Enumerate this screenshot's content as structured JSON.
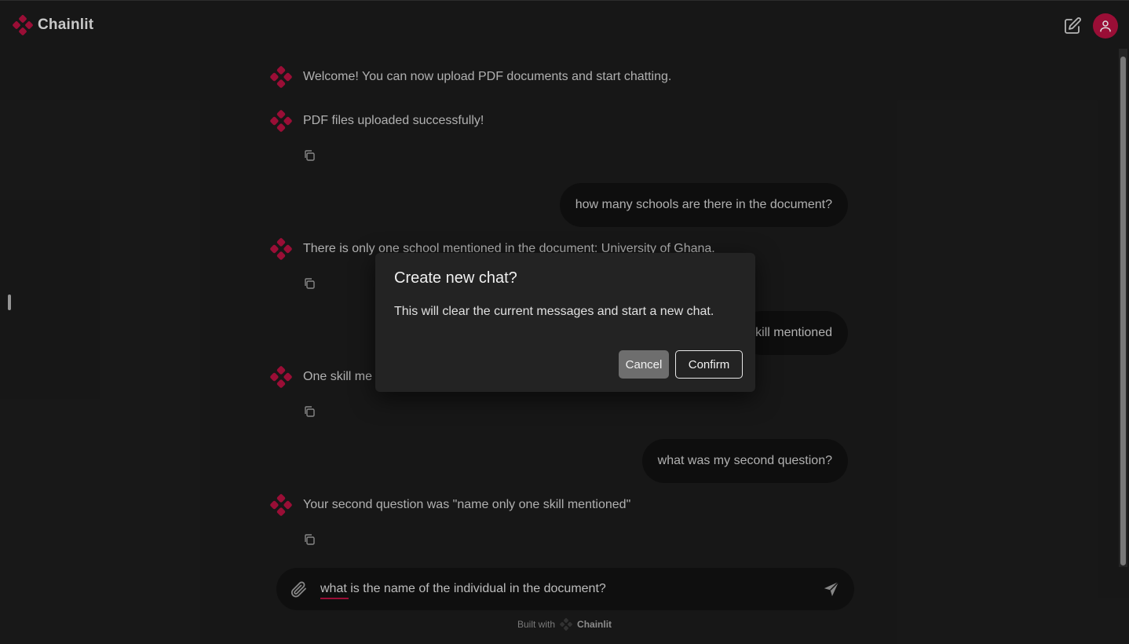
{
  "app": {
    "name": "Chainlit",
    "accent": "#b0103e"
  },
  "header": {
    "new_chat_icon": "edit-icon",
    "avatar_icon": "user-icon"
  },
  "messages": [
    {
      "role": "assistant",
      "text": "Welcome! You can now upload PDF documents and start chatting."
    },
    {
      "role": "assistant",
      "text": "PDF files uploaded successfully!"
    },
    {
      "role": "user",
      "text": "how many schools are there in the document?"
    },
    {
      "role": "assistant",
      "text": "There is only one school mentioned in the document: University of Ghana."
    },
    {
      "role": "user",
      "text": "kill mentioned"
    },
    {
      "role": "assistant",
      "text": "One skill me"
    },
    {
      "role": "user",
      "text": "what was my second question?"
    },
    {
      "role": "assistant",
      "text": "Your second question was \"name only one skill mentioned\""
    }
  ],
  "dialog": {
    "title": "Create new chat?",
    "body": "This will clear the current messages and start a new chat.",
    "cancel_label": "Cancel",
    "confirm_label": "Confirm"
  },
  "composer": {
    "value": "what is the name of the individual in the document?",
    "attach_icon": "paperclip-icon",
    "send_icon": "send-icon"
  },
  "footer": {
    "built_with": "Built with",
    "brand": "Chainlit"
  }
}
